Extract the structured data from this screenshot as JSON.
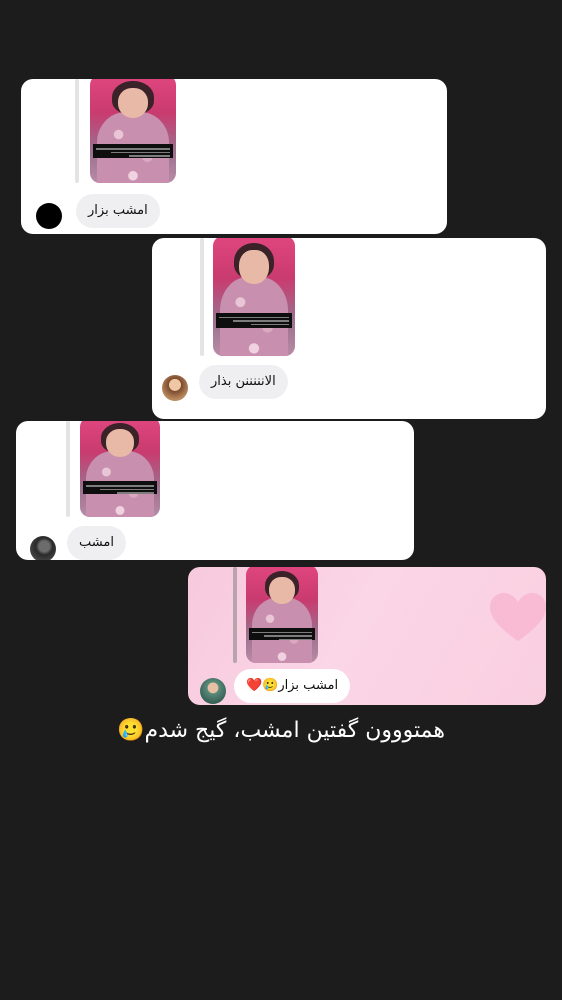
{
  "replies": [
    {
      "text": "امشب بزار"
    },
    {
      "text": "الانننننن بذار"
    },
    {
      "text": "امشب"
    },
    {
      "text": "امشب بزار🥲❤️"
    }
  ],
  "story_caption": "همتووون گفتین امشب، گیج شدم🥲",
  "colors": {
    "background": "#1c1c1c",
    "card": "#ffffff",
    "card_pink": "#f9cfe0",
    "bubble": "#efeff2"
  },
  "icons": [
    "heart-icon"
  ]
}
